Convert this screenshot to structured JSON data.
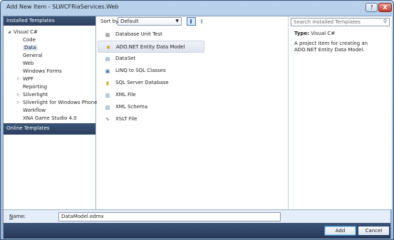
{
  "window": {
    "title": "Add New Item - SLWCFRiaServices.Web",
    "help_label": "?",
    "close_label": "X"
  },
  "left": {
    "header": "Installed Templates",
    "tree": [
      {
        "label": "Visual C#",
        "level": 0,
        "expanded": true,
        "arrow": "◢"
      },
      {
        "label": "Code",
        "level": 1
      },
      {
        "label": "Data",
        "level": 1,
        "selected": true
      },
      {
        "label": "General",
        "level": 1
      },
      {
        "label": "Web",
        "level": 1
      },
      {
        "label": "Windows Forms",
        "level": 1
      },
      {
        "label": "WPF",
        "level": 1,
        "arrow": "▷"
      },
      {
        "label": "Reporting",
        "level": 1
      },
      {
        "label": "Silverlight",
        "level": 1,
        "arrow": "▷"
      },
      {
        "label": "Silverlight for Windows Phone",
        "level": 1,
        "arrow": "▷"
      },
      {
        "label": "Workflow",
        "level": 1
      },
      {
        "label": "XNA Game Studio 4.0",
        "level": 1
      }
    ],
    "online_templates": "Online Templates"
  },
  "middle": {
    "sort_label": "Sort by:",
    "sort_value": "Default",
    "items": [
      {
        "label": "Database Unit Test",
        "icon": "database-unit-test-icon",
        "glyph": "▦",
        "color": "#7a7a7a"
      },
      {
        "label": "ADO.NET Entity Data Model",
        "icon": "entity-model-icon",
        "glyph": "✱",
        "color": "#d59b1e",
        "selected": true
      },
      {
        "label": "DataSet",
        "icon": "dataset-icon",
        "glyph": "▤",
        "color": "#4b78b0"
      },
      {
        "label": "LINQ to SQL Classes",
        "icon": "linq-icon",
        "glyph": "▣",
        "color": "#3f6fa6"
      },
      {
        "label": "SQL Server Database",
        "icon": "sql-database-icon",
        "glyph": "▮",
        "color": "#d4a32a"
      },
      {
        "label": "XML File",
        "icon": "xml-file-icon",
        "glyph": "▥",
        "color": "#5d7fa8"
      },
      {
        "label": "XML Schema",
        "icon": "xml-schema-icon",
        "glyph": "▧",
        "color": "#5d7fa8"
      },
      {
        "label": "XSLT File",
        "icon": "xslt-file-icon",
        "glyph": "✎",
        "color": "#6a6a6a"
      }
    ]
  },
  "right": {
    "search_placeholder": "Search Installed Templates",
    "type_label": "Type:",
    "type_value": "Visual C#",
    "description": "A project item for creating an ADO.NET Entity Data Model."
  },
  "bottom": {
    "name_label_underlined": "N",
    "name_label_rest": "ame:",
    "name_value": "DataModel.edmx",
    "add_label": "Add",
    "cancel_label": "Cancel"
  }
}
